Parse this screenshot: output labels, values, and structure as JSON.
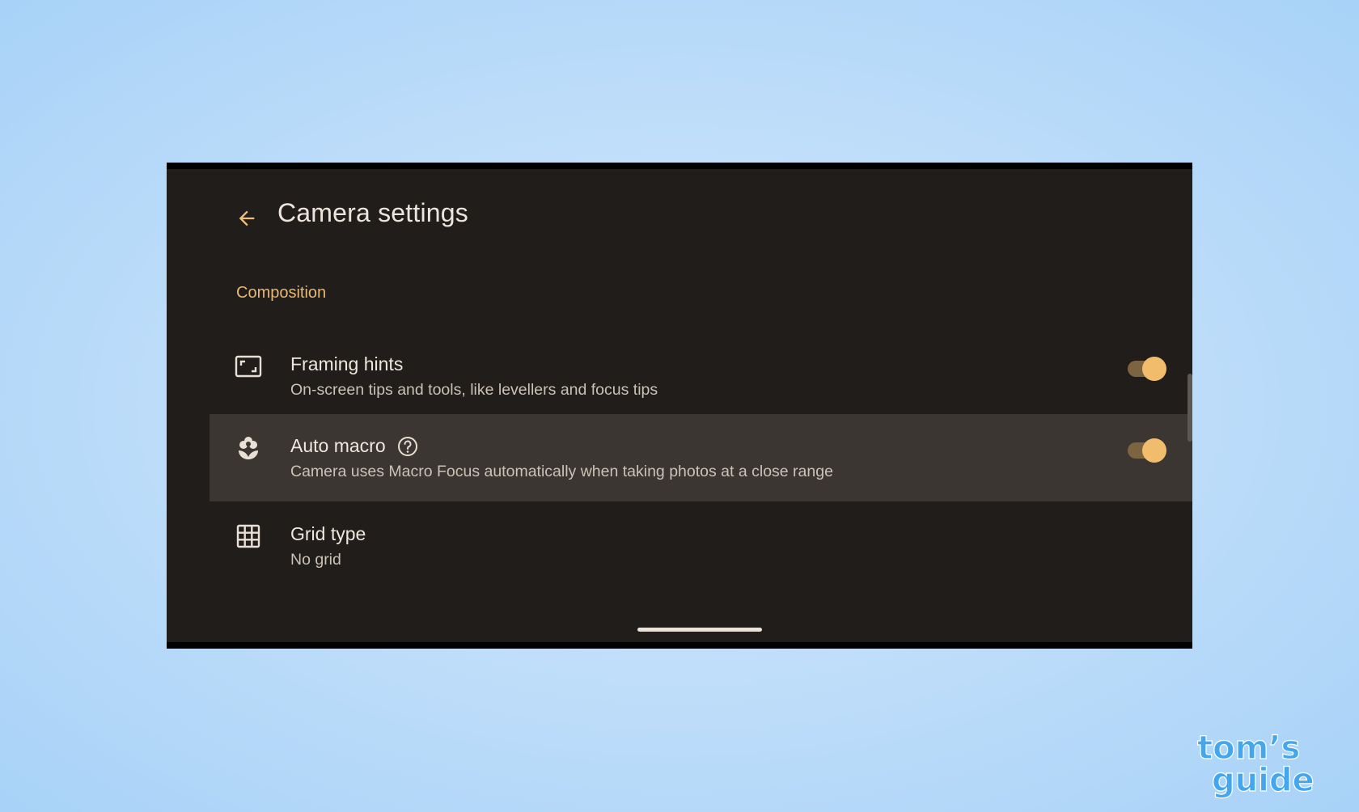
{
  "header": {
    "back_icon": "arrow-left-icon",
    "title": "Camera settings"
  },
  "section": {
    "title": "Composition"
  },
  "settings": [
    {
      "icon": "framing-frame-icon",
      "title": "Framing hints",
      "subtitle": "On-screen tips and tools, like levellers and focus tips",
      "toggle_on": true
    },
    {
      "icon": "macro-flower-icon",
      "title": "Auto macro",
      "help_icon": "help-circle-icon",
      "subtitle": "Camera uses Macro Focus automatically when taking photos at a close range",
      "toggle_on": true,
      "highlighted": true
    },
    {
      "icon": "grid-icon",
      "title": "Grid type",
      "subtitle": "No grid"
    }
  ],
  "watermark": {
    "line1": "tom's",
    "line2": "guide"
  },
  "colors": {
    "screen_bg": "#201d1a",
    "accent": "#e9b872",
    "toggle_thumb": "#f1bd6c",
    "highlight_row": "#3b3632",
    "watermark": "#42a7ee"
  }
}
